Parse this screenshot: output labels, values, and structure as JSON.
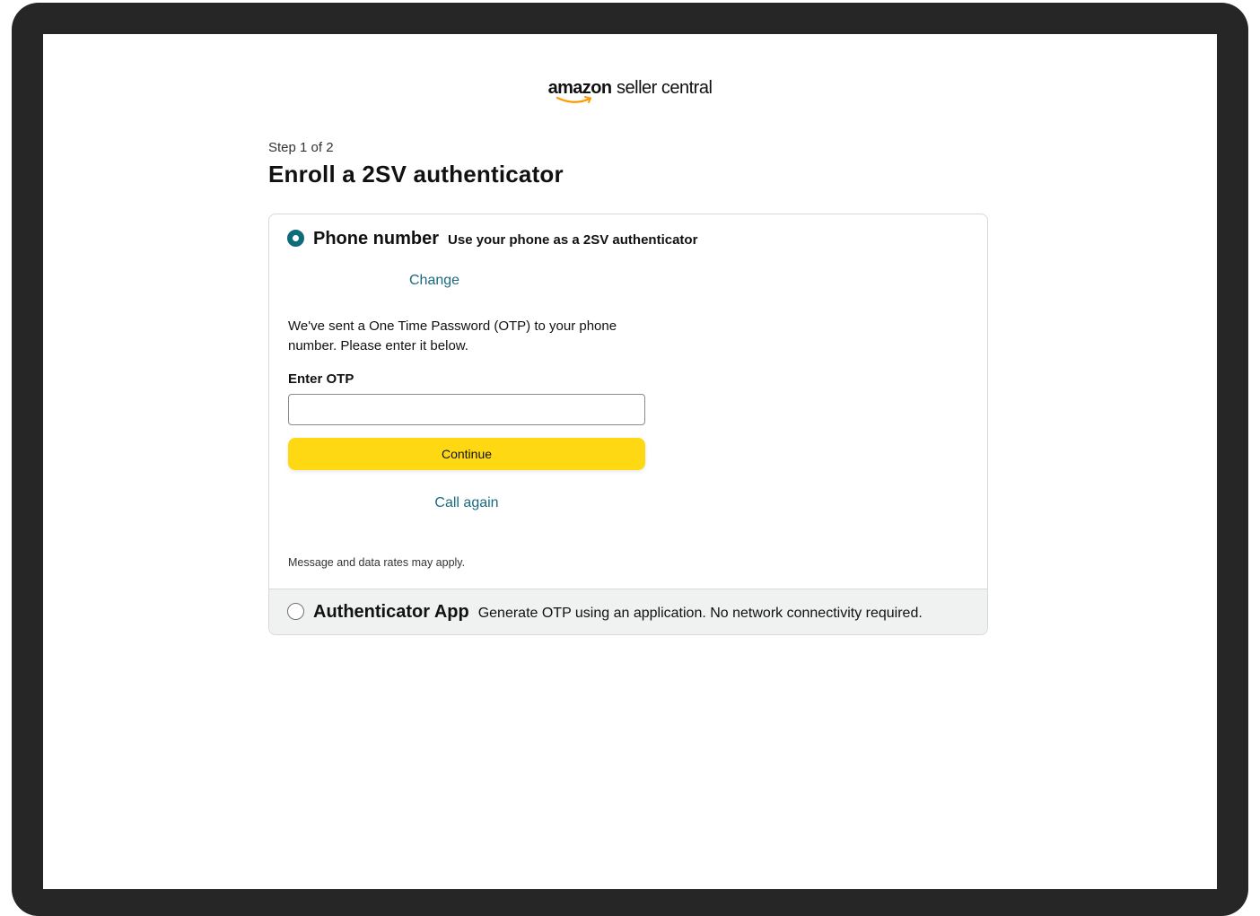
{
  "logo": {
    "brand": "amazon",
    "product": "seller central"
  },
  "step": "Step 1 of 2",
  "title": "Enroll a 2SV authenticator",
  "options": [
    {
      "name": "Phone number",
      "description": "Use your phone as a 2SV authenticator",
      "selected": true,
      "change_link": "Change",
      "message": "We've sent a One Time Password (OTP) to your phone number. Please enter it below.",
      "otp_label": "Enter OTP",
      "otp_value": "",
      "continue_label": "Continue",
      "call_again": "Call again",
      "rates_note": "Message and data rates may apply."
    },
    {
      "name": "Authenticator App",
      "description": "Generate OTP using an application. No network connectivity required.",
      "selected": false
    }
  ],
  "colors": {
    "accent": "#0f6b7a",
    "link": "#1a6a80",
    "button": "#ffd814",
    "logo_smile": "#ff9900"
  }
}
